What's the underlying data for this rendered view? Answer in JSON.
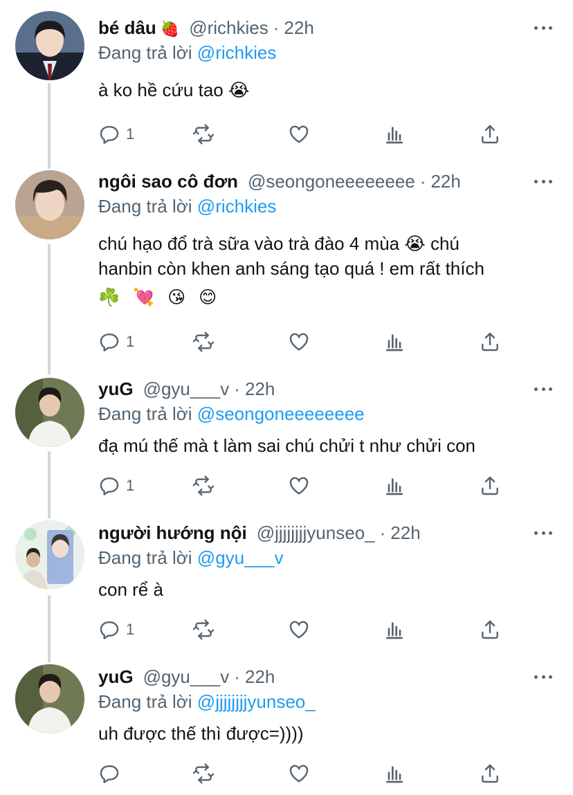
{
  "reply_prefix": "Đang trả lời",
  "tweets": [
    {
      "name": "bé dâu",
      "name_emoji": "🍓",
      "handle": "@richkies",
      "time": "22h",
      "reply_to": "@richkies",
      "text_lines": [
        "à ko hề cứu tao 😭"
      ],
      "emoji_line": "",
      "reply_count": "1"
    },
    {
      "name": "ngôi sao cô đơn",
      "name_emoji": "",
      "handle": "@seongoneeeeeeee",
      "time": "22h",
      "reply_to": "@richkies",
      "text_lines": [
        "chú hạo đổ trà sữa vào trà đào 4 mùa 😭  chú",
        "hanbin còn khen anh sáng tạo quá ! em rất thích"
      ],
      "emoji_line": "☘️ 💘 😘 😊",
      "reply_count": "1"
    },
    {
      "name": "yuG",
      "name_emoji": "",
      "handle": "@gyu___v",
      "time": "22h",
      "reply_to": "@seongoneeeeeeee",
      "text_lines": [
        "đạ mú thế mà t làm sai chú chửi t như chửi con"
      ],
      "emoji_line": "",
      "reply_count": "1"
    },
    {
      "name": "người hướng nội",
      "name_emoji": "",
      "handle": "@jjjjjjjjyunseo_",
      "time": "22h",
      "reply_to": "@gyu___v",
      "text_lines": [
        "con rể à"
      ],
      "emoji_line": "",
      "reply_count": "1"
    },
    {
      "name": "yuG",
      "name_emoji": "",
      "handle": "@gyu___v",
      "time": "22h",
      "reply_to": "@jjjjjjjjyunseo_",
      "text_lines": [
        "uh được thế thì được=))))"
      ],
      "emoji_line": "",
      "reply_count": ""
    }
  ],
  "colors": {
    "text": "#0f1419",
    "secondary": "#536471",
    "mention": "#1d9bf0",
    "thread_line": "#cfd9de"
  },
  "icons": [
    "reply-icon",
    "retweet-icon",
    "like-icon",
    "analytics-icon",
    "share-icon",
    "more-icon"
  ]
}
